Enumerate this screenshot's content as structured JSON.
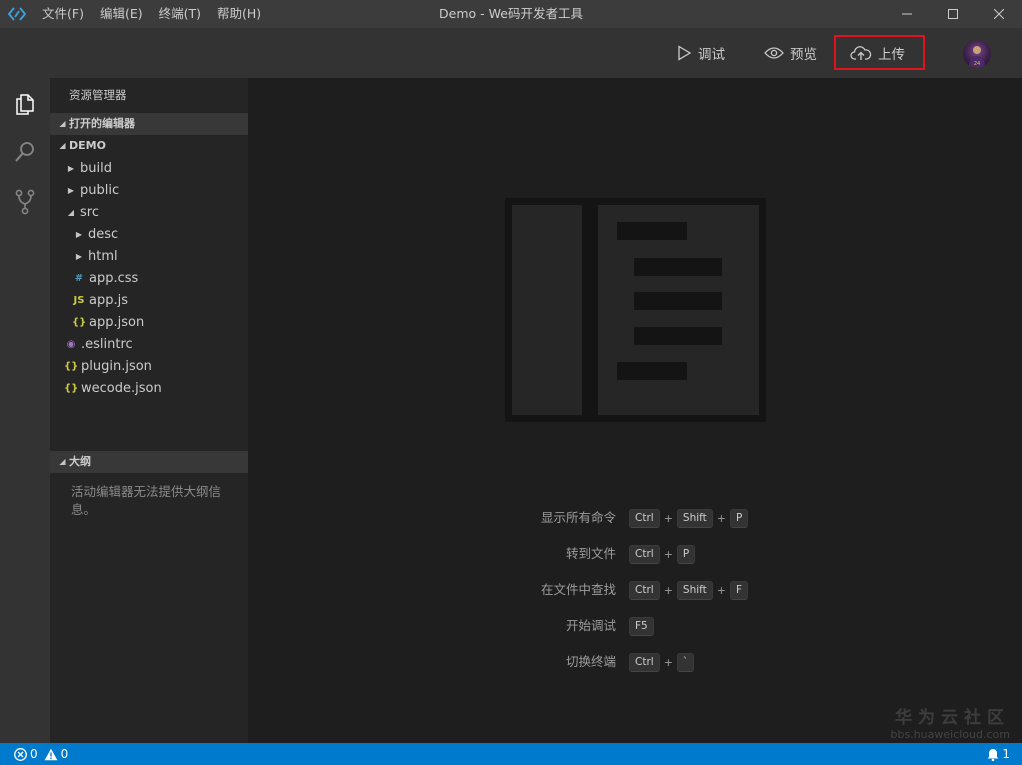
{
  "titlebar": {
    "title": "Demo - We码开发者工具",
    "menu": [
      {
        "label": "文件(F)"
      },
      {
        "label": "编辑(E)"
      },
      {
        "label": "终端(T)"
      },
      {
        "label": "帮助(H)"
      }
    ]
  },
  "toolbar": {
    "debug_label": "调试",
    "preview_label": "预览",
    "upload_label": "上传"
  },
  "sidebar": {
    "title": "资源管理器",
    "open_editors": "打开的编辑器",
    "project": "DEMO",
    "tree": [
      {
        "name": "build",
        "kind": "folder",
        "expanded": false,
        "depth": 0
      },
      {
        "name": "public",
        "kind": "folder",
        "expanded": false,
        "depth": 0
      },
      {
        "name": "src",
        "kind": "folder",
        "expanded": true,
        "depth": 0
      },
      {
        "name": "desc",
        "kind": "folder",
        "expanded": false,
        "depth": 1
      },
      {
        "name": "html",
        "kind": "folder",
        "expanded": false,
        "depth": 1
      },
      {
        "name": "app.css",
        "kind": "css",
        "depth": 1
      },
      {
        "name": "app.js",
        "kind": "js",
        "depth": 1
      },
      {
        "name": "app.json",
        "kind": "json",
        "depth": 1
      },
      {
        "name": ".eslintrc",
        "kind": "eslint",
        "depth": 0
      },
      {
        "name": "plugin.json",
        "kind": "json",
        "depth": 0
      },
      {
        "name": "wecode.json",
        "kind": "json",
        "depth": 0
      }
    ],
    "outline": {
      "title": "大纲",
      "message": "活动编辑器无法提供大纲信息。"
    }
  },
  "shortcuts": [
    {
      "label": "显示所有命令",
      "keys": [
        "Ctrl",
        "Shift",
        "P"
      ]
    },
    {
      "label": "转到文件",
      "keys": [
        "Ctrl",
        "P"
      ]
    },
    {
      "label": "在文件中查找",
      "keys": [
        "Ctrl",
        "Shift",
        "F"
      ]
    },
    {
      "label": "开始调试",
      "keys": [
        "F5"
      ]
    },
    {
      "label": "切换终端",
      "keys": [
        "Ctrl",
        "`"
      ]
    }
  ],
  "watermark": {
    "brand": "华为云社区",
    "url": "bbs.huaweicloud.com"
  },
  "statusbar": {
    "errors": "0",
    "warnings": "0",
    "notifications": "1"
  },
  "colors": {
    "statusbar": "#007acc",
    "upload_highlight": "#e0141a",
    "json_icon": "#cbcb41",
    "css_icon": "#519aba",
    "js_icon": "#cbcb41",
    "eslint_icon": "#a074c4"
  }
}
